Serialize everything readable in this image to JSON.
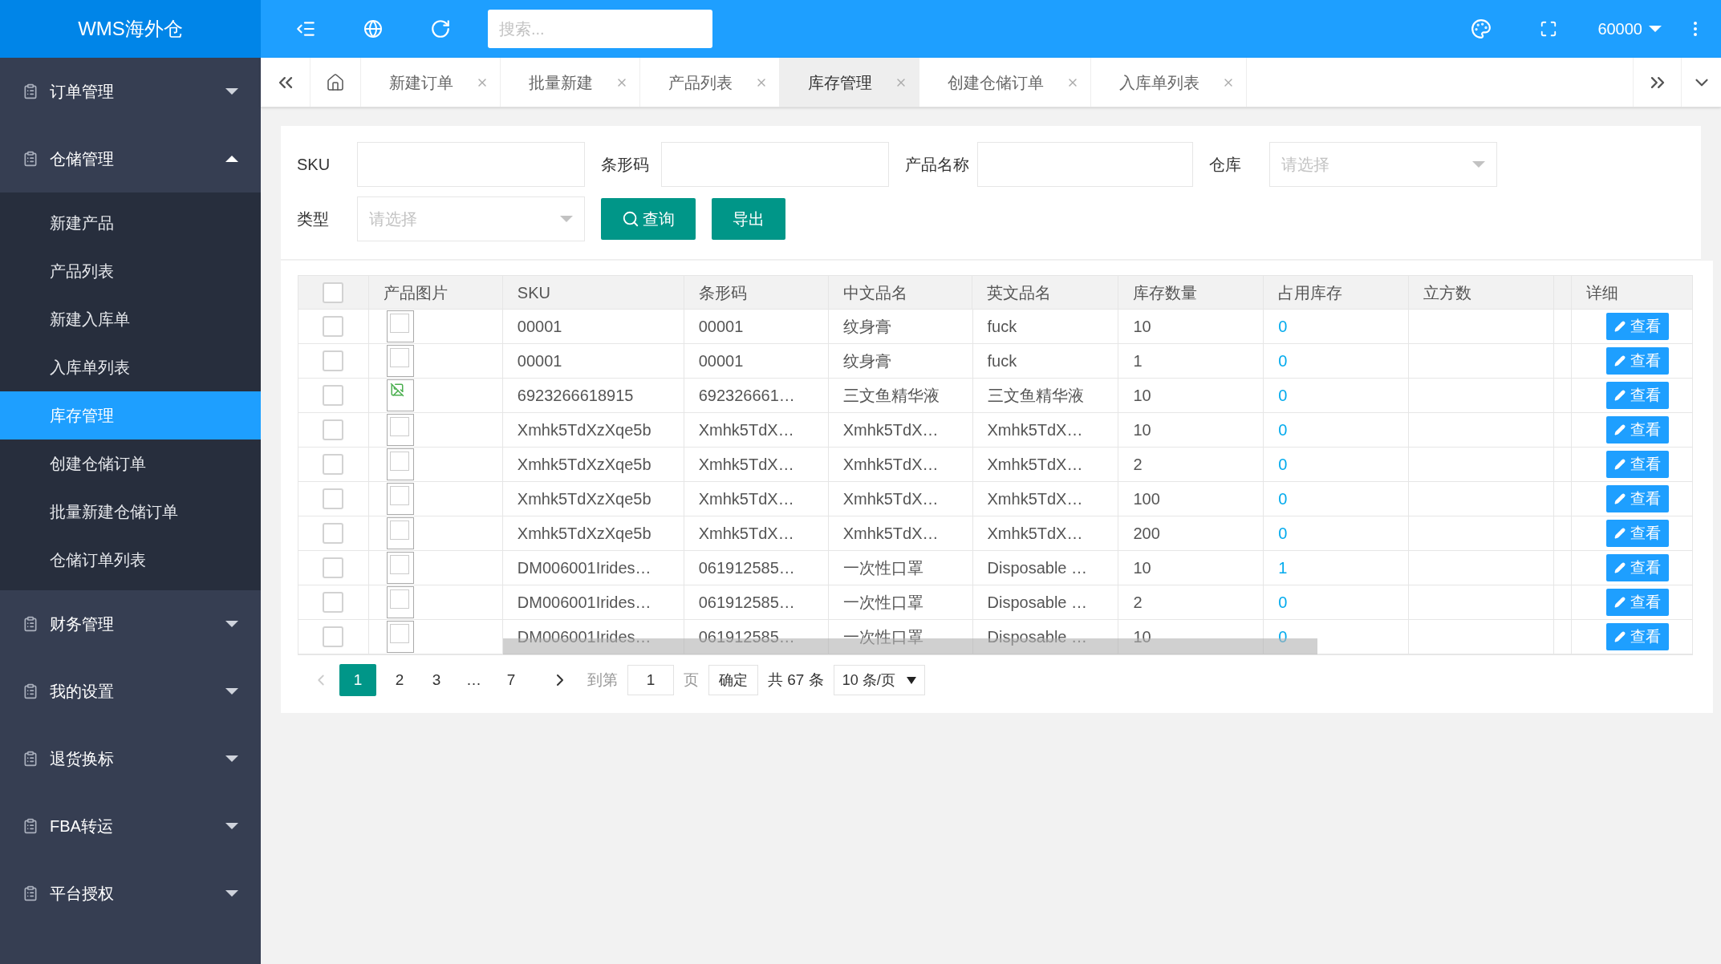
{
  "app_title": "WMS海外仓",
  "header": {
    "search_placeholder": "搜索...",
    "user": "60000"
  },
  "sidebar": {
    "menus": [
      {
        "label": "订单管理",
        "expanded": false
      },
      {
        "label": "仓储管理",
        "expanded": true,
        "children": [
          {
            "label": "新建产品",
            "selected": false
          },
          {
            "label": "产品列表",
            "selected": false
          },
          {
            "label": "新建入库单",
            "selected": false
          },
          {
            "label": "入库单列表",
            "selected": false
          },
          {
            "label": "库存管理",
            "selected": true
          },
          {
            "label": "创建仓储订单",
            "selected": false
          },
          {
            "label": "批量新建仓储订单",
            "selected": false
          },
          {
            "label": "仓储订单列表",
            "selected": false
          }
        ]
      },
      {
        "label": "财务管理",
        "expanded": false
      },
      {
        "label": "我的设置",
        "expanded": false
      },
      {
        "label": "退货换标",
        "expanded": false
      },
      {
        "label": "FBA转运",
        "expanded": false
      },
      {
        "label": "平台授权",
        "expanded": false
      }
    ]
  },
  "tabs": [
    {
      "label": "新建订单",
      "selected": false
    },
    {
      "label": "批量新建",
      "selected": false
    },
    {
      "label": "产品列表",
      "selected": false
    },
    {
      "label": "库存管理",
      "selected": true
    },
    {
      "label": "创建仓储订单",
      "selected": false
    },
    {
      "label": "入库单列表",
      "selected": false
    }
  ],
  "filters": [
    {
      "label": "SKU",
      "kind": "text"
    },
    {
      "label": "条形码",
      "kind": "text"
    },
    {
      "label": "产品名称",
      "kind": "text"
    },
    {
      "label": "仓库",
      "kind": "select",
      "placeholder": "请选择"
    },
    {
      "label": "类型",
      "kind": "select",
      "placeholder": "请选择"
    }
  ],
  "filter_buttons": [
    {
      "label": "查询",
      "kind": "search"
    },
    {
      "label": "导出",
      "kind": "plain"
    }
  ],
  "table": {
    "image_header": "产品图片",
    "columns": [
      "SKU",
      "条形码",
      "中文品名",
      "英文品名",
      "库存数量",
      "占用库存",
      "立方数"
    ],
    "action_header": "详细",
    "header_checked": false,
    "rows": [
      {
        "checked": false,
        "kind": "empty",
        "cells": [
          "00001",
          "00001",
          "纹身膏",
          "fuck",
          "10",
          "0"
        ],
        "action": "查看"
      },
      {
        "checked": false,
        "kind": "empty",
        "cells": [
          "00001",
          "00001",
          "纹身膏",
          "fuck",
          "1",
          "0"
        ],
        "action": "查看"
      },
      {
        "checked": false,
        "kind": "broken",
        "cells": [
          "6923266618915",
          "692326661…",
          "三文鱼精华液",
          "三文鱼精华液",
          "10",
          "0"
        ],
        "action": "查看"
      },
      {
        "checked": false,
        "kind": "empty",
        "cells": [
          "Xmhk5TdXzXqe5b",
          "Xmhk5TdX…",
          "Xmhk5TdX…",
          "Xmhk5TdX…",
          "10",
          "0"
        ],
        "action": "查看"
      },
      {
        "checked": false,
        "kind": "empty",
        "cells": [
          "Xmhk5TdXzXqe5b",
          "Xmhk5TdX…",
          "Xmhk5TdX…",
          "Xmhk5TdX…",
          "2",
          "0"
        ],
        "action": "查看"
      },
      {
        "checked": false,
        "kind": "empty",
        "cells": [
          "Xmhk5TdXzXqe5b",
          "Xmhk5TdX…",
          "Xmhk5TdX…",
          "Xmhk5TdX…",
          "100",
          "0"
        ],
        "action": "查看"
      },
      {
        "checked": false,
        "kind": "empty",
        "cells": [
          "Xmhk5TdXzXqe5b",
          "Xmhk5TdX…",
          "Xmhk5TdX…",
          "Xmhk5TdX…",
          "200",
          "0"
        ],
        "action": "查看"
      },
      {
        "checked": false,
        "kind": "empty",
        "cells": [
          "DM006001Irides…",
          "061912585…",
          "一次性口罩",
          "Disposable …",
          "10",
          "1"
        ],
        "action": "查看"
      },
      {
        "checked": false,
        "kind": "empty",
        "cells": [
          "DM006001Irides…",
          "061912585…",
          "一次性口罩",
          "Disposable …",
          "2",
          "0"
        ],
        "action": "查看"
      },
      {
        "checked": false,
        "kind": "empty",
        "cells": [
          "DM006001Irides…",
          "061912585…",
          "一次性口罩",
          "Disposable …",
          "10",
          "0"
        ],
        "action": "查看"
      }
    ]
  },
  "pagination": {
    "pages": [
      {
        "label": "1",
        "selected": true
      },
      {
        "label": "2",
        "selected": false
      },
      {
        "label": "3",
        "selected": false
      },
      {
        "label": "…",
        "selected": false
      },
      {
        "label": "7",
        "selected": false
      }
    ],
    "goto_label": "到第",
    "goto_value": "1",
    "page_unit": "页",
    "confirm": "确定",
    "total": "共 67 条",
    "page_size": "10 条/页"
  }
}
